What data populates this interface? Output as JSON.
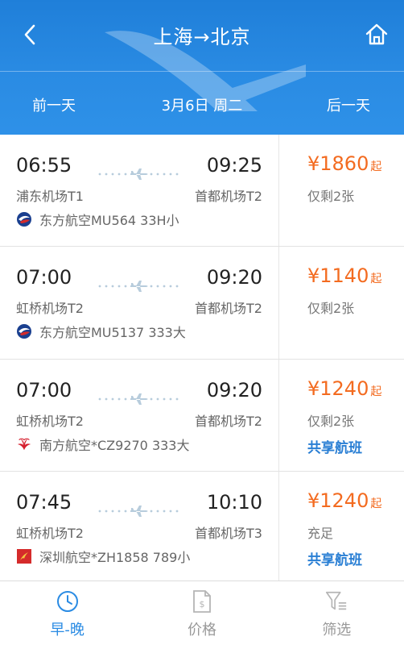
{
  "header": {
    "title": "上海→北京",
    "prev_label": "前一天",
    "date_label": "3月6日 周二",
    "next_label": "后一天",
    "back_icon": "chevron-left-icon",
    "home_icon": "home-icon"
  },
  "colors": {
    "header_blue": "#2a8be3",
    "price_orange": "#f36b20",
    "link_blue": "#2a7fd4"
  },
  "flights": [
    {
      "dep_time": "06:55",
      "arr_time": "09:25",
      "dep_airport": "浦东机场T1",
      "arr_airport": "首都机场T2",
      "airline": "东方航空MU564 33H小",
      "airline_logo": "china-eastern-logo",
      "price": "¥1860",
      "price_suffix": "起",
      "remain": "仅剩2张",
      "shared": ""
    },
    {
      "dep_time": "07:00",
      "arr_time": "09:20",
      "dep_airport": "虹桥机场T2",
      "arr_airport": "首都机场T2",
      "airline": "东方航空MU5137 333大",
      "airline_logo": "china-eastern-logo",
      "price": "¥1140",
      "price_suffix": "起",
      "remain": "仅剩2张",
      "shared": ""
    },
    {
      "dep_time": "07:00",
      "arr_time": "09:20",
      "dep_airport": "虹桥机场T2",
      "arr_airport": "首都机场T2",
      "airline": "南方航空*CZ9270 333大",
      "airline_logo": "china-southern-logo",
      "price": "¥1240",
      "price_suffix": "起",
      "remain": "仅剩2张",
      "shared": "共享航班"
    },
    {
      "dep_time": "07:45",
      "arr_time": "10:10",
      "dep_airport": "虹桥机场T2",
      "arr_airport": "首都机场T3",
      "airline": "深圳航空*ZH1858 789小",
      "airline_logo": "shenzhen-airlines-logo",
      "price": "¥1240",
      "price_suffix": "起",
      "remain": "充足",
      "shared": "共享航班"
    }
  ],
  "tabs": [
    {
      "label": "早-晚",
      "icon": "clock-icon",
      "active": true
    },
    {
      "label": "价格",
      "icon": "price-icon",
      "active": false
    },
    {
      "label": "筛选",
      "icon": "filter-icon",
      "active": false
    }
  ]
}
